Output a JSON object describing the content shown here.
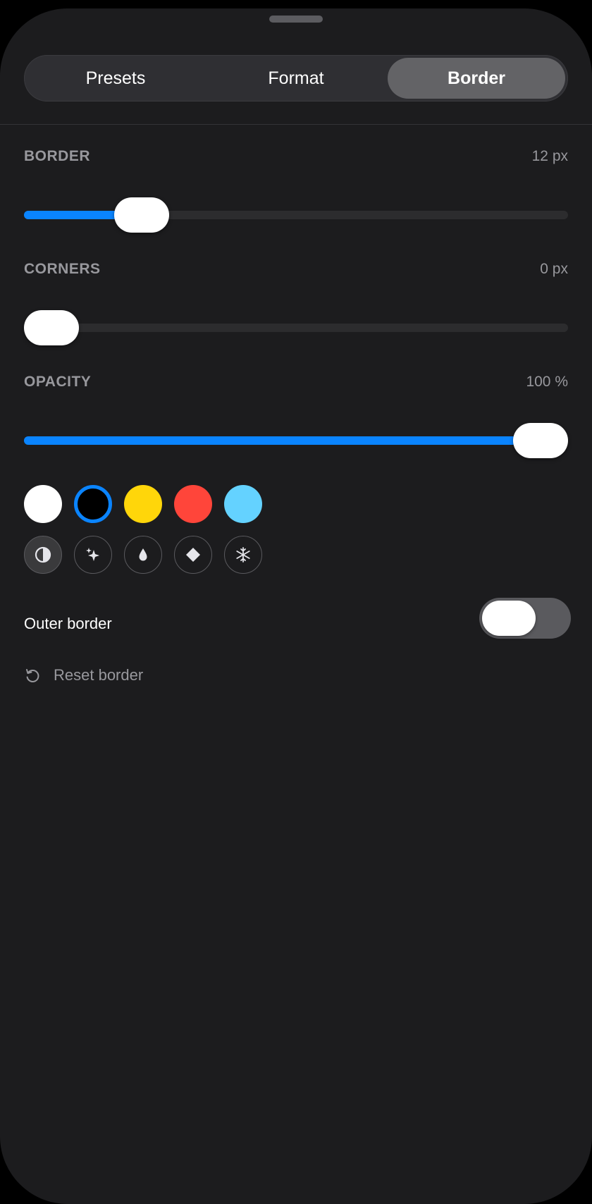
{
  "tabs": [
    {
      "label": "Presets",
      "active": false
    },
    {
      "label": "Format",
      "active": false
    },
    {
      "label": "Border",
      "active": true
    }
  ],
  "sliders": {
    "border": {
      "label": "BORDER",
      "value_text": "12 px",
      "fraction": 0.185
    },
    "corners": {
      "label": "CORNERS",
      "value_text": "0 px",
      "fraction": 0.0
    },
    "opacity": {
      "label": "OPACITY",
      "value_text": "100 %",
      "fraction": 1.0
    }
  },
  "colors": [
    {
      "name": "white",
      "hex": "#ffffff",
      "selected": false
    },
    {
      "name": "black",
      "hex": "#000000",
      "selected": true
    },
    {
      "name": "yellow",
      "hex": "#ffd60a",
      "selected": false
    },
    {
      "name": "red",
      "hex": "#ff453a",
      "selected": false
    },
    {
      "name": "light-blue",
      "hex": "#64d2ff",
      "selected": false
    }
  ],
  "effects": [
    {
      "icon": "contrast-icon",
      "active": true
    },
    {
      "icon": "sparkles-icon",
      "active": false
    },
    {
      "icon": "drop-icon",
      "active": false
    },
    {
      "icon": "diamond-icon",
      "active": false
    },
    {
      "icon": "snowflake-icon",
      "active": false
    }
  ],
  "outer_border": {
    "label": "Outer border",
    "on": false
  },
  "reset": {
    "label": "Reset border",
    "icon": "reset-icon"
  },
  "accent_color": "#0a84ff"
}
